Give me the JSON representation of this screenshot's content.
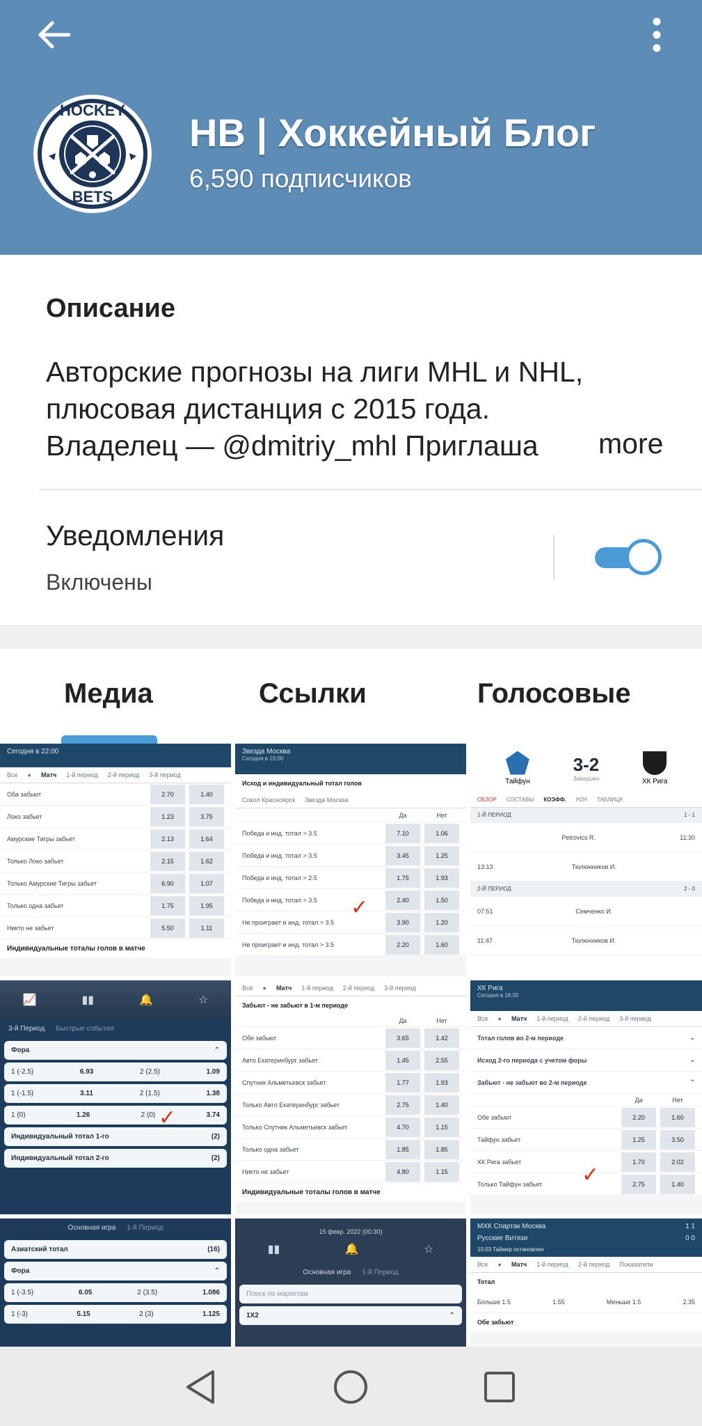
{
  "header": {
    "channel_title": "НВ | Хоккейный Блог",
    "subscribers": "6,590 подписчиков",
    "background_color": "#5d8cb7",
    "back_icon": "arrow-left-icon",
    "menu_icon": "more-vertical-icon",
    "avatar_text_top": "HOCKEY",
    "avatar_text_bottom": "BETS"
  },
  "description": {
    "heading": "Описание",
    "line1": "Авторские прогнозы на лиги MHL и NHL,",
    "line2": "плюсовая дистанция с 2015 года.",
    "line3": "Владелец — @dmitriy_mhl  Приглаша",
    "more_label": "more"
  },
  "notifications": {
    "title": "Уведомления",
    "status": "Включены",
    "enabled": true,
    "accent_color": "#4a9ad6"
  },
  "tabs": [
    {
      "label": "Медиа",
      "active": true
    },
    {
      "label": "Ссылки",
      "active": false
    },
    {
      "label": "Голосовые",
      "active": false
    }
  ],
  "media": {
    "cell1": {
      "header": "Сегодня в 22:00",
      "subtabs": [
        "Все",
        "●",
        "Матч",
        "1-й период",
        "2-й период",
        "3-й период"
      ],
      "rows": [
        {
          "label": "Оба забьют",
          "a": "2.70",
          "b": "1.40"
        },
        {
          "label": "Локо забьет",
          "a": "1.23",
          "b": "3.75"
        },
        {
          "label": "Амурские Тигры забьет",
          "a": "2.13",
          "b": "1.64"
        },
        {
          "label": "Только Локо забьет",
          "a": "2.15",
          "b": "1.62"
        },
        {
          "label": "Только Амурские Тигры забьет",
          "a": "6.90",
          "b": "1.07"
        },
        {
          "label": "Только одна забьет",
          "a": "1.75",
          "b": "1.95"
        },
        {
          "label": "Никто не забьет",
          "a": "5.50",
          "b": "1.11"
        }
      ],
      "caption": "Индивидуальные тоталы голов в матче"
    },
    "cell2": {
      "header": "Звезда Москва",
      "subheader": "Сегодня в 19:00",
      "section": "Исход и индивидуальный тотал голов",
      "teams": [
        "Сокол Красноярск",
        "Звезда Москва"
      ],
      "cols": [
        "Да",
        "Нет"
      ],
      "rows": [
        {
          "label": "Победа и инд. тотал > 3.5",
          "a": "7.10",
          "b": "1.06"
        },
        {
          "label": "Победа и инд. тотал > 3.5",
          "a": "3.45",
          "b": "1.25"
        },
        {
          "label": "Победа и инд. тотал > 2.5",
          "a": "1.75",
          "b": "1.93"
        },
        {
          "label": "Победа и инд. тотал > 3.5",
          "a": "2.40",
          "b": "1.50"
        },
        {
          "label": "Не проиграет и инд. тотал > 3.5",
          "a": "3.90",
          "b": "1.20"
        },
        {
          "label": "Не проиграет и инд. тотал > 3.5",
          "a": "2.20",
          "b": "1.60"
        }
      ]
    },
    "cell3": {
      "score": "3-2",
      "status": "Завершен",
      "team1": "Тайфун",
      "team2": "ХК Рига",
      "subtabs": [
        "ОБЗОР",
        "СОСТАВЫ",
        "КОЭФФ.",
        "Н2Н",
        "ТАБЛИЦА"
      ],
      "period1": "1-Й ПЕРИОД",
      "period1_score": "1 - 1",
      "period2": "2-Й ПЕРИОД",
      "period2_score": "2 - 0",
      "events": [
        {
          "time": "11:30",
          "player": "Petrovics R."
        },
        {
          "time": "13:13",
          "player": "Тюлюнников И."
        },
        {
          "time": "07:51",
          "player": "Семченко И."
        },
        {
          "time": "11:47",
          "player": "Тюлюнников И."
        }
      ]
    },
    "cell4": {
      "tabs": [
        "3-й Период",
        "Быстрые события"
      ],
      "section": "Фора",
      "rows": [
        {
          "label": "1 (-2.5)",
          "a": "6.93",
          "mid": "2 (2.5)",
          "b": "1.09"
        },
        {
          "label": "1 (-1.5)",
          "a": "3.11",
          "mid": "2 (1.5)",
          "b": "1.38"
        },
        {
          "label": "1 (0)",
          "a": "1.26",
          "mid": "2 (0)",
          "b": "3.74"
        }
      ],
      "items": [
        {
          "label": "Индивидуальный тотал 1-го",
          "count": "(2)"
        },
        {
          "label": "Индивидуальный тотал 2-го",
          "count": "(2)"
        }
      ]
    },
    "cell5": {
      "subtabs": [
        "Все",
        "●",
        "Матч",
        "1-й период",
        "2-й период",
        "3-й период"
      ],
      "section": "Забьют - не забьют в 1-м периоде",
      "cols": [
        "Да",
        "Нет"
      ],
      "rows": [
        {
          "label": "Обе забьют",
          "a": "3.65",
          "b": "1.42"
        },
        {
          "label": "Авто Екатеринбург забьет",
          "a": "1.45",
          "b": "2.55"
        },
        {
          "label": "Спутник Альметьевск забьет",
          "a": "1.77",
          "b": "1.93"
        },
        {
          "label": "Только Авто Екатеринбург забьет",
          "a": "2.75",
          "b": "1.40"
        },
        {
          "label": "Только Спутник Альметьевск забьет",
          "a": "4.70",
          "b": "1.15"
        },
        {
          "label": "Только одна забьет",
          "a": "1.85",
          "b": "1.85"
        },
        {
          "label": "Никто не забьет",
          "a": "4.80",
          "b": "1.15"
        }
      ],
      "caption": "Индивидуальные тоталы голов в матче"
    },
    "cell6": {
      "header": "ХК Рига",
      "subheader": "Сегодня в 16:00",
      "subtabs": [
        "Все",
        "●",
        "Матч",
        "1-й период",
        "2-й период",
        "3-й период"
      ],
      "sections": [
        "Тотал голов во 2-м периоде",
        "Исход 2-го периода с учетом форы",
        "Забьют - не забьют во 2-м периоде"
      ],
      "cols": [
        "Да",
        "Нет"
      ],
      "rows": [
        {
          "label": "Обе забьют",
          "a": "2.20",
          "b": "1.60"
        },
        {
          "label": "Тайфун забьет",
          "a": "1.25",
          "b": "3.50"
        },
        {
          "label": "ХК Рига забьет",
          "a": "1.70",
          "b": "2.02"
        },
        {
          "label": "Только Тайфун забьет",
          "a": "2.75",
          "b": "1.40"
        }
      ]
    },
    "cell7": {
      "tabs": [
        "Основная игра",
        "1-й Период"
      ],
      "items": [
        {
          "label": "Азиатский тотал",
          "count": "(16)"
        }
      ],
      "section": "Фора",
      "rows": [
        {
          "label": "1 (-3.5)",
          "a": "6.05",
          "mid": "2 (3.5)",
          "b": "1.086"
        },
        {
          "label": "1 (-3)",
          "a": "5.15",
          "mid": "2 (3)",
          "b": "1.125"
        }
      ]
    },
    "cell8": {
      "date": "15 февр. 2022 (00:30)",
      "tabs": [
        "Основная игра",
        "1-й Период"
      ],
      "search_placeholder": "Поиск по маркетам",
      "section": "1X2"
    },
    "cell9": {
      "team1": "МХК Спартак Москва",
      "team1_score": "1  1",
      "team2": "Русские Витязи",
      "team2_score": "0  0",
      "status": "15:03  Таймер остановлен",
      "subtabs": [
        "Все",
        "●",
        "Матч",
        "1-й период",
        "2-й период",
        "Показатели"
      ],
      "section": "Тотал",
      "row": {
        "label1": "Больше 1.5",
        "a": "1.55",
        "label2": "Меньше 1.5",
        "b": "2.35"
      },
      "footer": "Обе забьют"
    }
  },
  "navbar": {
    "back_icon": "triangle-back-icon",
    "home_icon": "circle-home-icon",
    "recents_icon": "square-recents-icon"
  }
}
